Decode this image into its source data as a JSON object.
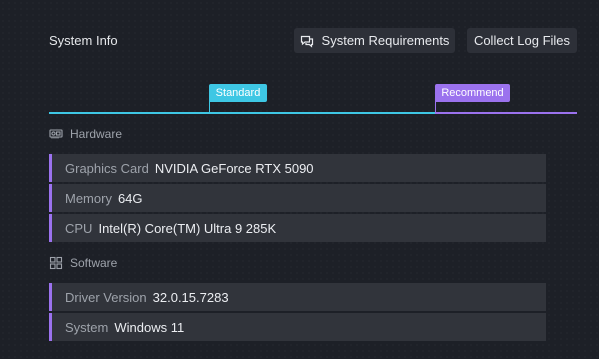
{
  "header": {
    "title": "System Info",
    "system_requirements_label": "System Requirements",
    "collect_logs_label": "Collect Log Files"
  },
  "tiers": {
    "standard_label": "Standard",
    "recommend_label": "Recommend",
    "standard_color": "#3ec7e4",
    "recommend_color": "#9b72ee"
  },
  "hardware": {
    "title": "Hardware",
    "icon": "gpu-card-icon",
    "rows": [
      {
        "label": "Graphics Card",
        "value": "NVIDIA GeForce RTX 5090"
      },
      {
        "label": "Memory",
        "value": "64G"
      },
      {
        "label": "CPU",
        "value": "Intel(R) Core(TM) Ultra 9 285K"
      }
    ]
  },
  "software": {
    "title": "Software",
    "icon": "windows-icon",
    "rows": [
      {
        "label": "Driver Version",
        "value": "32.0.15.7283"
      },
      {
        "label": "System",
        "value": "Windows 11"
      }
    ]
  },
  "colors": {
    "background": "#1d2027",
    "row_background": "#31343b",
    "button_background": "#2d3038",
    "accent": "#9b72ee"
  }
}
